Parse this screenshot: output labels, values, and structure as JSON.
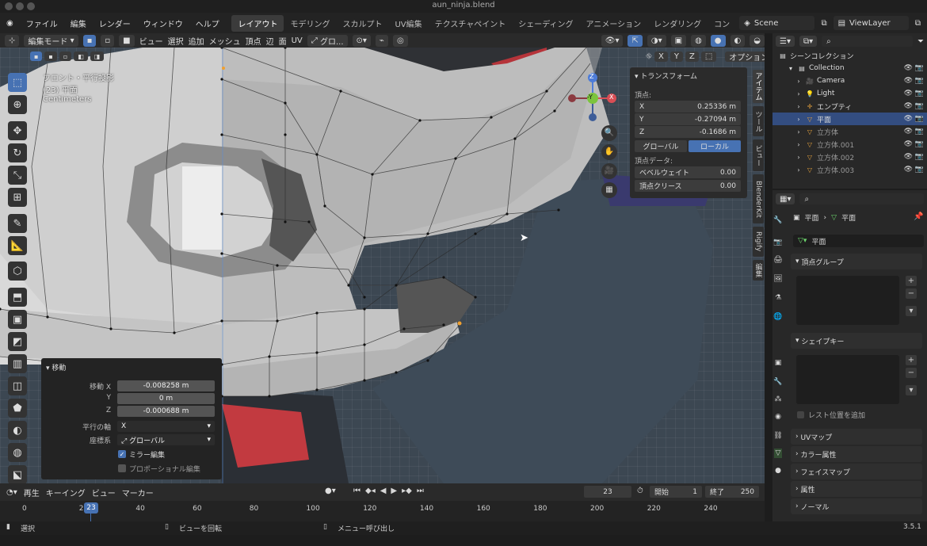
{
  "window": {
    "title": "aun_ninja.blend"
  },
  "menu": [
    "ファイル",
    "編集",
    "レンダー",
    "ウィンドウ",
    "ヘルプ"
  ],
  "workspaces": [
    "レイアウト",
    "モデリング",
    "スカルプト",
    "UV編集",
    "テクスチャペイント",
    "シェーディング",
    "アニメーション",
    "レンダリング",
    "コン"
  ],
  "active_workspace": "レイアウト",
  "scene": "Scene",
  "view_layer": "ViewLayer",
  "header": {
    "mode": "編集モード",
    "menus": [
      "ビュー",
      "選択",
      "追加",
      "メッシュ",
      "頂点",
      "辺",
      "面",
      "UV"
    ],
    "orientation": "グロ...",
    "options": "オプション",
    "axes": [
      "X",
      "Y",
      "Z"
    ]
  },
  "viewport": {
    "info_line1": "フロント・平行投影",
    "info_line2": "(23) 平面",
    "info_line3": "Centimeters",
    "gizmo": {
      "z": "Z",
      "y": "-Y",
      "x": "X"
    }
  },
  "transform_panel": {
    "title": "トランスフォーム",
    "vertex_label": "頂点:",
    "x_label": "X",
    "x": "0.25336 m",
    "y_label": "Y",
    "y": "-0.27094 m",
    "z_label": "Z",
    "z": "-0.1686 m",
    "global": "グローバル",
    "local": "ローカル",
    "vertex_data": "頂点データ:",
    "bevel_weight_label": "ベベルウェイト",
    "bevel_weight": "0.00",
    "crease_label": "頂点クリース",
    "crease": "0.00"
  },
  "side_tabs": [
    "アイテム",
    "ツール",
    "ビュー",
    "BlenderKit",
    "Rigify",
    "編集"
  ],
  "operator_panel": {
    "title": "移動",
    "move_x_label": "移動 X",
    "move_x": "-0.008258 m",
    "move_y_label": "Y",
    "move_y": "0 m",
    "move_z_label": "Z",
    "move_z": "-0.000688 m",
    "constraint_label": "平行の軸",
    "constraint": "X",
    "orientation_label": "座標系",
    "orientation": "グローバル",
    "mirror_edit": "ミラー編集",
    "proportional": "プロポーショナル編集"
  },
  "timeline": {
    "menus": [
      "再生",
      "キーイング",
      "ビュー",
      "マーカー"
    ],
    "current_frame": "23",
    "start_label": "開始",
    "start": "1",
    "end_label": "終了",
    "end": "250",
    "ticks": [
      "0",
      "20",
      "40",
      "60",
      "80",
      "100",
      "120",
      "140",
      "160",
      "180",
      "200",
      "220",
      "240"
    ],
    "playhead": "23"
  },
  "statusbar": {
    "select": "選択",
    "rotate": "ビューを回転",
    "menu": "メニュー呼び出し",
    "version": "3.5.1"
  },
  "outliner": {
    "scene_collection": "シーンコレクション",
    "items": [
      {
        "name": "Collection",
        "indent": 1
      },
      {
        "name": "Camera",
        "indent": 2
      },
      {
        "name": "Light",
        "indent": 2
      },
      {
        "name": "エンプティ",
        "indent": 2
      },
      {
        "name": "平面",
        "indent": 2
      },
      {
        "name": "立方体",
        "indent": 2
      },
      {
        "name": "立方体.001",
        "indent": 2
      },
      {
        "name": "立方体.002",
        "indent": 2
      },
      {
        "name": "立方体.003",
        "indent": 2
      }
    ]
  },
  "properties": {
    "breadcrumb_obj": "平面",
    "breadcrumb_mesh": "平面",
    "mesh_name": "平面",
    "sections": [
      "頂点グループ",
      "シェイプキー"
    ],
    "relative_key": "レスト位置を追加",
    "collapsed": [
      "UVマップ",
      "カラー属性",
      "フェイスマップ",
      "属性",
      "ノーマル"
    ]
  },
  "colors": {
    "accent": "#4772b3",
    "selection": "#334d80",
    "bg": "#1d1d1d",
    "panel": "#282828"
  }
}
